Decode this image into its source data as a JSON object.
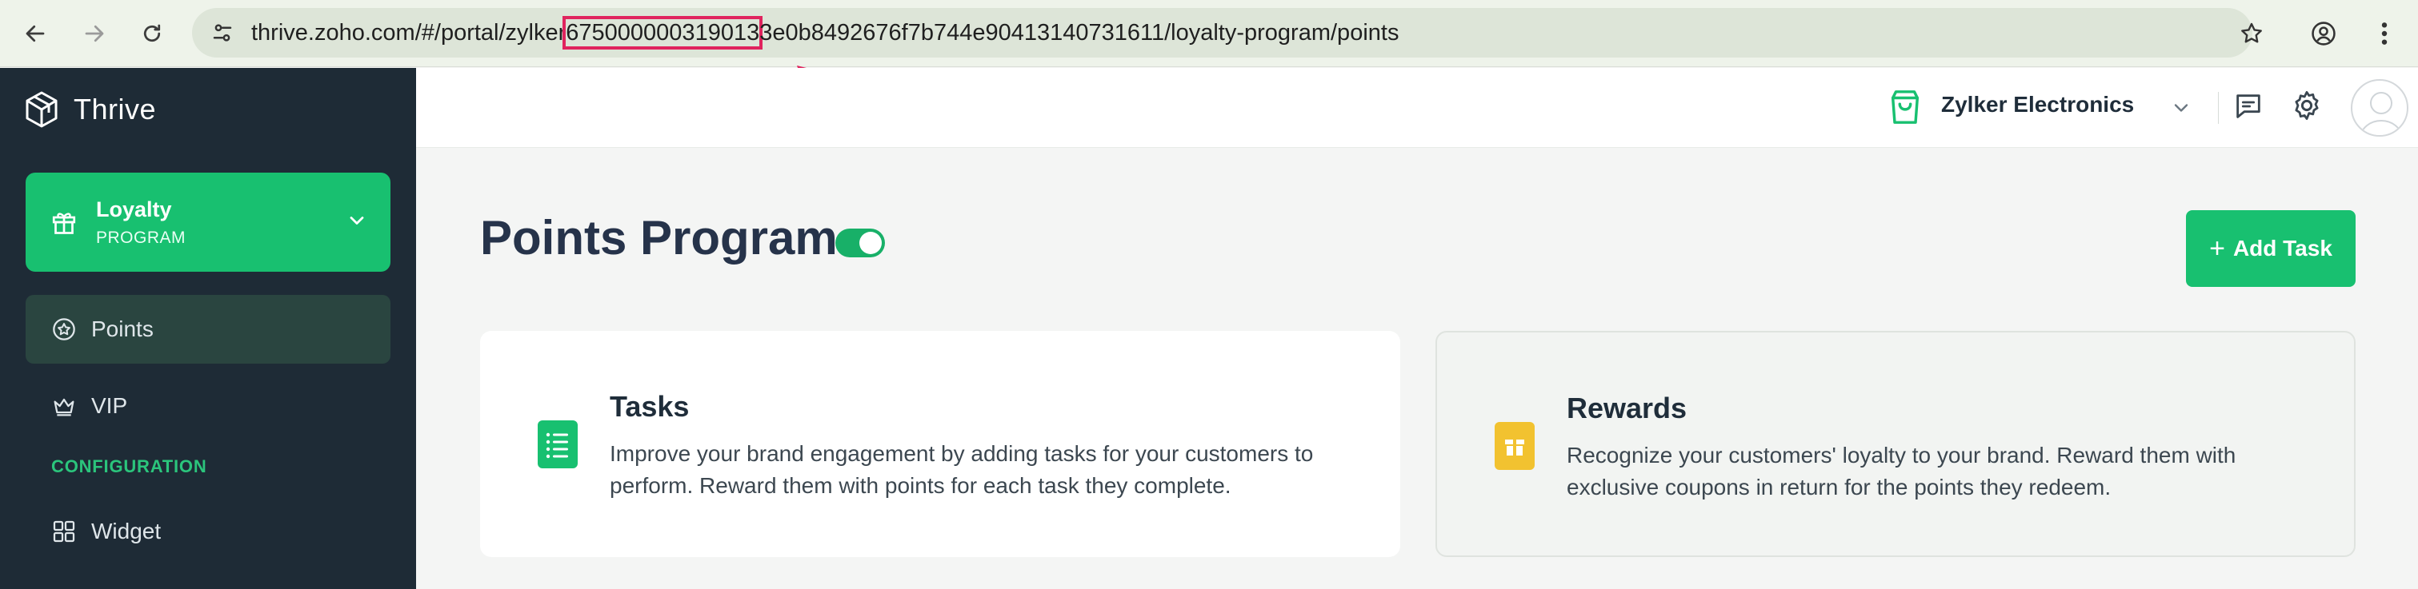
{
  "browser": {
    "url_prefix": "thrive.zoho.com/#/portal/zylker",
    "url_highlight": "675000000319013",
    "url_suffix": "3e0b8492676f7b744e90413140731611/loyalty-program/points",
    "highlight_color": "#e0245e"
  },
  "sidebar": {
    "brand": "Thrive",
    "loyalty": {
      "title": "Loyalty",
      "subtitle": "PROGRAM"
    },
    "items": [
      {
        "label": "Points",
        "icon": "star-badge-icon",
        "active": true
      },
      {
        "label": "VIP",
        "icon": "crown-icon",
        "active": false
      }
    ],
    "config_heading": "CONFIGURATION",
    "config_items": [
      {
        "label": "Widget",
        "icon": "grid-icon"
      }
    ]
  },
  "header": {
    "store_name": "Zylker Electronics"
  },
  "main": {
    "title": "Points Program",
    "toggle_on": true,
    "add_task_plus": "+",
    "add_task_label": "Add Task",
    "cards": [
      {
        "title": "Tasks",
        "description": "Improve your brand engagement by adding tasks for your customers to perform. Reward them with points for each task they complete.",
        "icon": "task-list-icon",
        "icon_color": "#18c070"
      },
      {
        "title": "Rewards",
        "description": "Recognize your customers' loyalty to your brand. Reward them with exclusive coupons in return for the points they redeem.",
        "icon": "gift-icon",
        "icon_color": "#f2c230"
      }
    ]
  },
  "colors": {
    "accent": "#18c070",
    "sidebar_bg": "#1e2b36"
  }
}
